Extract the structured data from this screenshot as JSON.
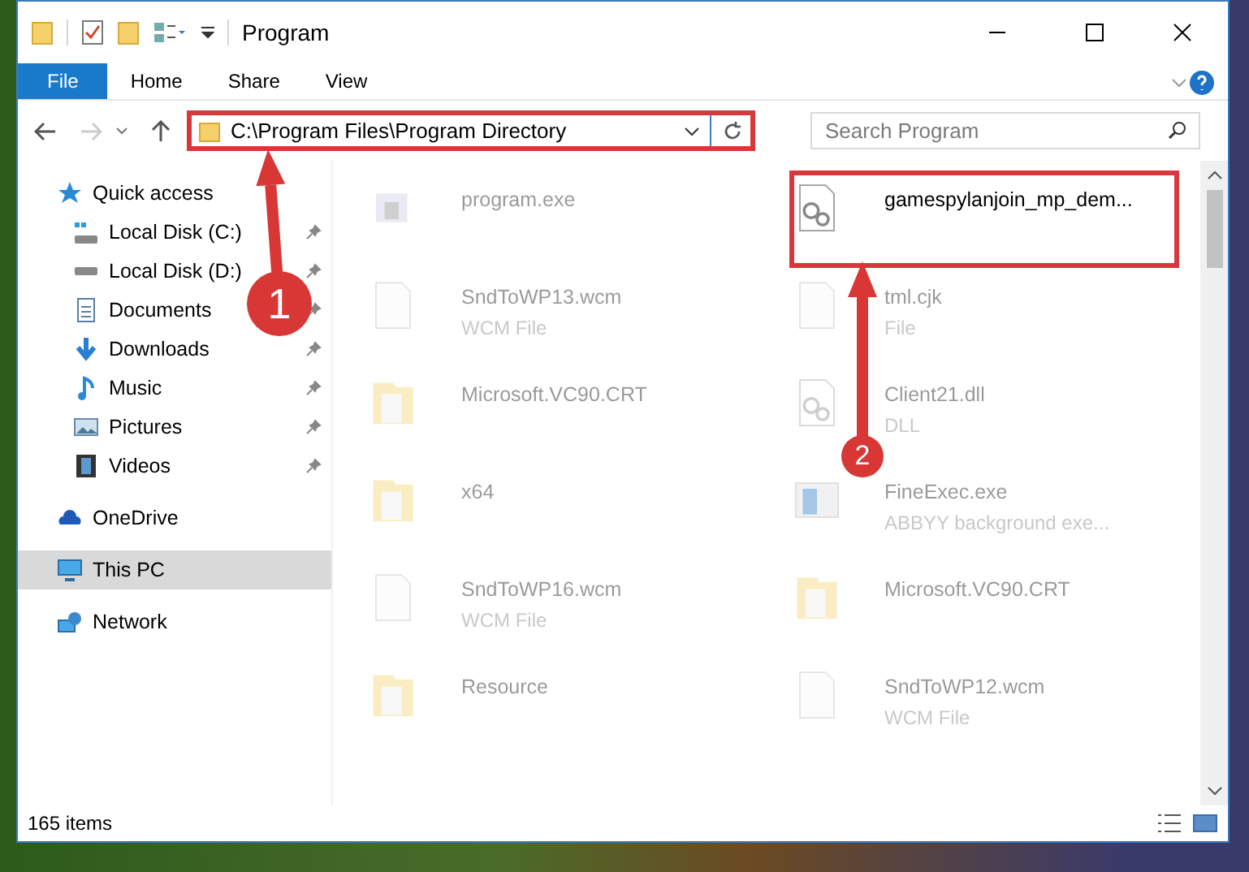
{
  "window": {
    "title": "Program"
  },
  "ribbon": {
    "tabs": [
      {
        "label": "File",
        "selected": true
      },
      {
        "label": "Home",
        "selected": false
      },
      {
        "label": "Share",
        "selected": false
      },
      {
        "label": "View",
        "selected": false
      }
    ]
  },
  "address_bar": {
    "path": "C:\\Program Files\\Program Directory",
    "highlighted": true
  },
  "search": {
    "placeholder": "Search Program"
  },
  "sidebar": {
    "items": [
      {
        "label": "Quick access",
        "selected": false,
        "children": [
          {
            "label": "Local Disk (C:)",
            "pinned": true
          },
          {
            "label": "Local Disk (D:)",
            "pinned": true
          },
          {
            "label": "Documents",
            "pinned": true
          },
          {
            "label": "Downloads",
            "pinned": true
          },
          {
            "label": "Music",
            "pinned": true
          },
          {
            "label": "Pictures",
            "pinned": true
          },
          {
            "label": "Videos",
            "pinned": true
          }
        ]
      },
      {
        "label": "OneDrive",
        "selected": false
      },
      {
        "label": "This PC",
        "selected": true
      },
      {
        "label": "Network",
        "selected": false
      }
    ]
  },
  "files": [
    {
      "kind": "exe",
      "name": "program.exe",
      "dimmed": true,
      "highlighted": false
    },
    {
      "kind": "settings",
      "name": "gamespylanjoin_mp_dem...",
      "dimmed": false,
      "highlighted": true
    },
    {
      "kind": "file",
      "name": "SndToWP13.wcm",
      "type": "WCM File",
      "dimmed": true,
      "highlighted": false
    },
    {
      "kind": "file",
      "name": "tml.cjk",
      "type": "File",
      "dimmed": true,
      "highlighted": false
    },
    {
      "kind": "folder",
      "name": "Microsoft.VC90.CRT",
      "dimmed": true,
      "highlighted": false
    },
    {
      "kind": "settings",
      "name": "Client21.dll",
      "type": "DLL",
      "dimmed": true,
      "highlighted": false
    },
    {
      "kind": "folder",
      "name": "x64",
      "dimmed": true,
      "highlighted": false
    },
    {
      "kind": "app",
      "name": "FineExec.exe",
      "type": "ABBYY background exe...",
      "dimmed": true,
      "highlighted": false
    },
    {
      "kind": "file",
      "name": "SndToWP16.wcm",
      "type": "WCM File",
      "dimmed": true,
      "highlighted": false
    },
    {
      "kind": "folder",
      "name": "Microsoft.VC90.CRT",
      "dimmed": true,
      "highlighted": false
    },
    {
      "kind": "folder",
      "name": "Resource",
      "dimmed": true,
      "highlighted": false
    },
    {
      "kind": "file",
      "name": "SndToWP12.wcm",
      "type": "WCM File",
      "dimmed": true,
      "highlighted": false
    }
  ],
  "annotations": [
    {
      "label": "1"
    },
    {
      "label": "2"
    }
  ],
  "status_bar": {
    "count": "165 items"
  }
}
